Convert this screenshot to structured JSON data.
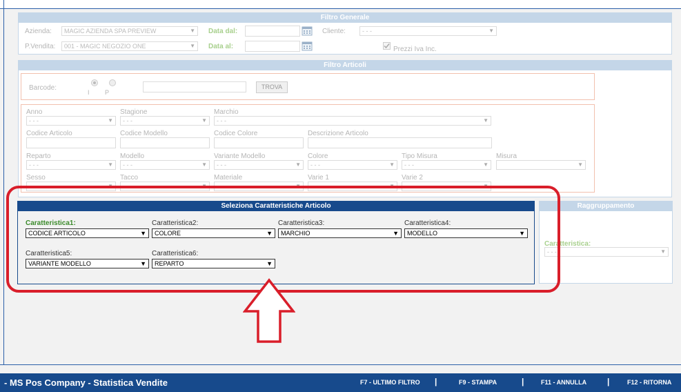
{
  "filtro_generale": {
    "title": "Filtro Generale",
    "azienda_label": "Azienda:",
    "azienda_value": "MAGIC AZIENDA SPA PREVIEW",
    "pvendita_label": "P.Vendita:",
    "pvendita_value": "001 - MAGIC NEGOZIO ONE",
    "data_dal_label": "Data dal:",
    "data_al_label": "Data al:",
    "cliente_label": "Cliente:",
    "cliente_value": "- - -",
    "prezzi_iva_label": "Prezzi Iva Inc."
  },
  "filtro_articoli": {
    "title": "Filtro Articoli",
    "barcode_label": "Barcode:",
    "radio_i": "I",
    "radio_p": "P",
    "trova_label": "TROVA",
    "fields": [
      {
        "label": "Anno",
        "value": "- - -"
      },
      {
        "label": "Stagione",
        "value": "- - -"
      },
      {
        "label": "Marchio",
        "value": "- - -"
      },
      {
        "label": "Codice Articolo",
        "value": ""
      },
      {
        "label": "Codice Modello",
        "value": ""
      },
      {
        "label": "Codice Colore",
        "value": ""
      },
      {
        "label": "Descrizione Articolo",
        "value": ""
      },
      {
        "label": "Reparto",
        "value": "- - -"
      },
      {
        "label": "Modello",
        "value": "- - -"
      },
      {
        "label": "Variante Modello",
        "value": "- - -"
      },
      {
        "label": "Colore",
        "value": "- - -"
      },
      {
        "label": "Tipo Misura",
        "value": "- - -"
      },
      {
        "label": "Misura",
        "value": ""
      },
      {
        "label": "Sesso",
        "value": ""
      },
      {
        "label": "Tacco",
        "value": ""
      },
      {
        "label": "Materiale",
        "value": ""
      },
      {
        "label": "Varie 1",
        "value": ""
      },
      {
        "label": "Varie 2",
        "value": ""
      }
    ]
  },
  "caratteristiche": {
    "title": "Seleziona Caratteristiche Articolo",
    "items": [
      {
        "label": "Caratteristica1:",
        "value": "CODICE ARTICOLO"
      },
      {
        "label": "Caratteristica2:",
        "value": "COLORE"
      },
      {
        "label": "Caratteristica3:",
        "value": "MARCHIO"
      },
      {
        "label": "Caratteristica4:",
        "value": "MODELLO"
      },
      {
        "label": "Caratteristica5:",
        "value": "VARIANTE MODELLO"
      },
      {
        "label": "Caratteristica6:",
        "value": "REPARTO"
      }
    ]
  },
  "raggruppamento": {
    "title": "Raggruppamento",
    "label": "Caratteristica:",
    "value": "- - -"
  },
  "footer": {
    "title": "- MS Pos Company - Statistica Vendite",
    "f7": "F7 - ULTIMO FILTRO",
    "f9": "F9 - STAMPA",
    "f11": "F11 - ANNULLA",
    "f12": "F12 - RITORNA",
    "separator": "|"
  },
  "colors": {
    "accent": "#174a8c",
    "highlight": "#d91e2a",
    "panel_header": "#c4d6e8"
  },
  "icons": {
    "calendar": "calendar-icon",
    "dropdown": "chevron-down-icon",
    "arrow": "up-arrow-annotation"
  }
}
